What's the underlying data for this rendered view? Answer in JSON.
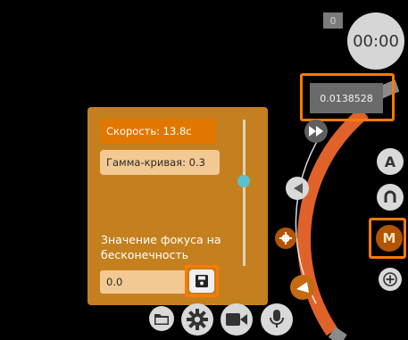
{
  "top": {
    "counter": "0",
    "timer": "00:00"
  },
  "readout": {
    "value": "0.0138528"
  },
  "right_controls": {
    "mode_a_label": "A",
    "manual_label": "M"
  },
  "focus_panel": {
    "speed_label": "Скорость: 13.8с",
    "gamma_label": "Гамма-кривая: 0.3",
    "focus_label": "Значение фокуса на бесконечность",
    "focus_value": "0.0",
    "slider_level": 0.58
  },
  "colors": {
    "accent": "#ff7a00",
    "panel": "#c4801f",
    "dial": "#e0622a",
    "slider": "#5cc1ce"
  },
  "icons": {
    "fast_forward": "fast-forward-icon",
    "rewind": "rewind-icon",
    "settings": "gear-icon",
    "horn": "horn-icon",
    "save": "floppy-icon",
    "folder": "folder-icon",
    "camera": "video-camera-icon",
    "mic": "microphone-icon"
  }
}
